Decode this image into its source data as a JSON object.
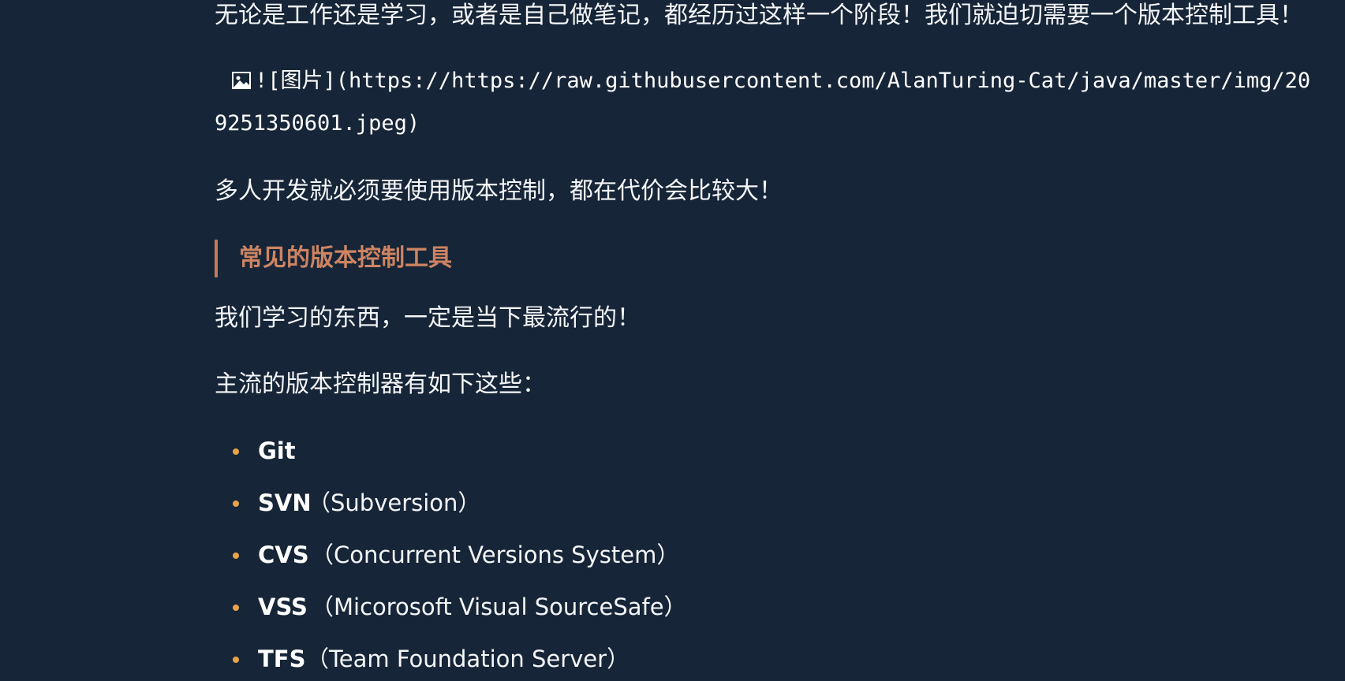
{
  "paragraphs": {
    "intro": "无论是工作还是学习，或者是自己做笔记，都经历过这样一个阶段！我们就迫切需要一个版本控制工具！",
    "team": "多人开发就必须要使用版本控制，都在代价会比较大！",
    "learn": "我们学习的东西，一定是当下最流行的！",
    "mainstream": "主流的版本控制器有如下这些："
  },
  "image_ref": {
    "icon": "broken-image-icon",
    "line1": "![图片](https://https://raw.githubusercontent.com/AlanTuring-Cat/java/master/img/20",
    "line2": "9251350601.jpeg)"
  },
  "heading": "常见的版本控制工具",
  "tools": [
    {
      "name": "Git",
      "desc": ""
    },
    {
      "name": "SVN",
      "desc": "（Subversion）"
    },
    {
      "name": "CVS",
      "desc": "（Concurrent Versions System）"
    },
    {
      "name": "VSS",
      "desc": "（Micorosoft Visual SourceSafe）"
    },
    {
      "name": "TFS",
      "desc": "（Team Foundation Server）"
    }
  ],
  "colors": {
    "background": "#162537",
    "heading": "#cd8462",
    "bullet": "#e8a449"
  }
}
